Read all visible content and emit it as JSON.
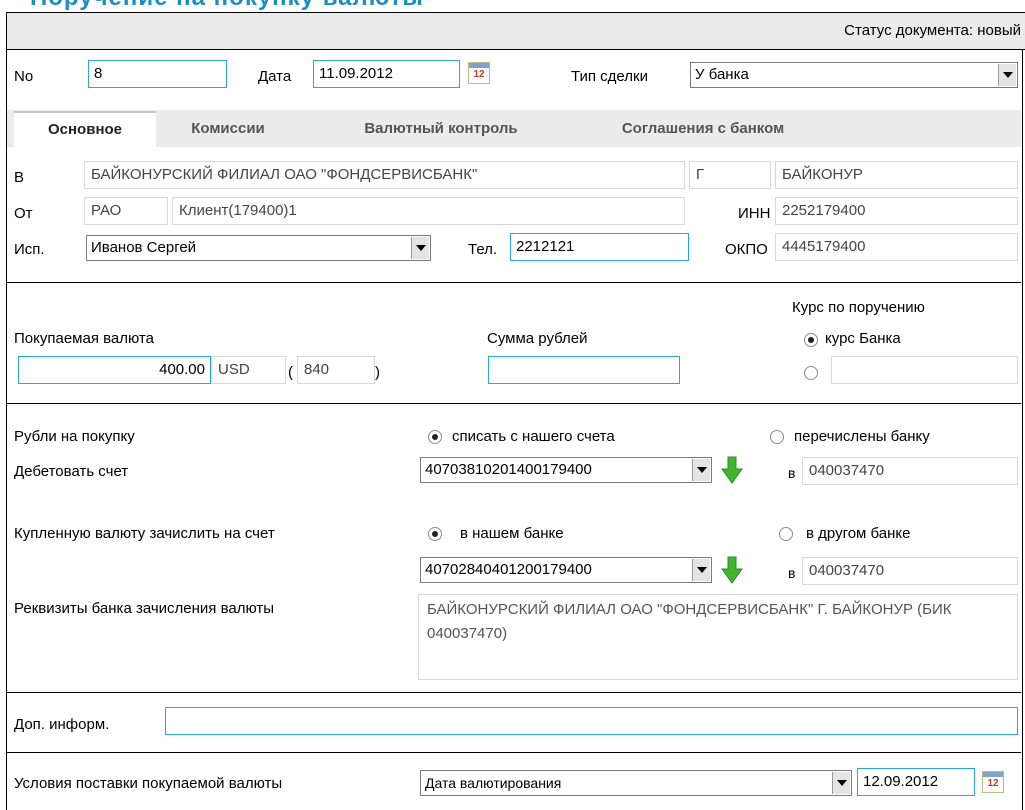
{
  "window_title": "Поручение на покупку валюты",
  "status": "Статус документа: новый",
  "header": {
    "no_label": "No",
    "no_value": "8",
    "date_label": "Дата",
    "date_value": "11.09.2012",
    "calendar_day": "12",
    "deal_type_label": "Тип сделки",
    "deal_type_value": "У банка"
  },
  "tabs": [
    {
      "label": "Основное",
      "active": true
    },
    {
      "label": "Комиссии"
    },
    {
      "label": "Валютный контроль"
    },
    {
      "label": "Соглашения с банком"
    }
  ],
  "bank": {
    "to_label": "В",
    "to_value": "БАЙКОНУРСКИЙ ФИЛИАЛ ОАО \"ФОНДСЕРВИСБАНК\"",
    "city_prefix": "Г",
    "city_value": "БАЙКОНУР",
    "from_label": "От",
    "from_code": "РАО",
    "from_value": "Клиент(179400)1",
    "inn_label": "ИНН",
    "inn_value": "2252179400",
    "exec_label": "Исп.",
    "exec_value": "Иванов Сергей",
    "phone_label": "Тел.",
    "phone_value": "2212121",
    "okpo_label": "ОКПО",
    "okpo_value": "4445179400"
  },
  "currency": {
    "label": "Покупаемая валюта",
    "amount": "400.00",
    "code": "USD",
    "paren_open": "(",
    "num_code": "840",
    "paren_close": ")",
    "rub_label": "Сумма рублей",
    "rub_value": "",
    "rate_label": "Курс по поручению",
    "rate_option_bank": "курс Банка",
    "rate_custom": ""
  },
  "rubles": {
    "label": "Рубли на покупку",
    "option_debit": "списать с нашего счета",
    "option_transferred": "перечислены банку",
    "debit_label": "Дебетовать счет",
    "debit_account": "40703810201400179400",
    "in_label": "в",
    "debit_bik": "040037470"
  },
  "credit": {
    "label": "Купленную валюту зачислить на счет",
    "option_our_bank": "в нашем банке",
    "option_other_bank": "в другом банке",
    "account": "40702840401200179400",
    "in_label": "в",
    "bik": "040037470",
    "requisites_label": "Реквизиты банка зачисления валюты",
    "requisites_value": "БАЙКОНУРСКИЙ ФИЛИАЛ ОАО \"ФОНДСЕРВИСБАНК\" Г. БАЙКОНУР (БИК 040037470)"
  },
  "extra": {
    "label": "Доп. информ.",
    "value": ""
  },
  "delivery": {
    "label": "Условия поставки покупаемой валюты",
    "value": "Дата валютирования",
    "date": "12.09.2012",
    "calendar_day": "12"
  },
  "colors": {
    "accent": "#2aa6e0",
    "title": "#1c8fc2",
    "arrow": "#3fb52f"
  }
}
